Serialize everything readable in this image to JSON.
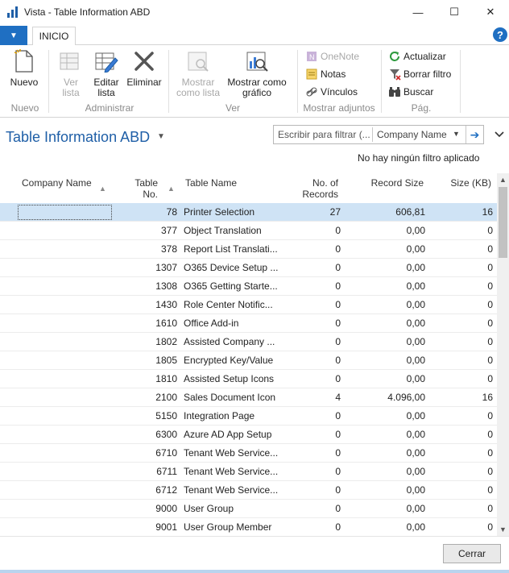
{
  "window": {
    "title": "Vista - Table Information ABD",
    "minimize_glyph": "—",
    "maximize_glyph": "☐",
    "close_glyph": "✕"
  },
  "ribbon_tabs": {
    "file_glyph": "▼",
    "active_tab": "INICIO",
    "help_glyph": "?"
  },
  "ribbon": {
    "groups": {
      "nuevo": "Nuevo",
      "administrar": "Administrar",
      "ver": "Ver",
      "mostrar_adjuntos": "Mostrar adjuntos",
      "pag": "Pág."
    },
    "buttons": {
      "nuevo": "Nuevo",
      "ver_lista": "Ver lista",
      "editar_lista": "Editar lista",
      "eliminar": "Eliminar",
      "mostrar_como_lista": "Mostrar como lista",
      "mostrar_como_grafico": "Mostrar como gráfico",
      "onenote": "OneNote",
      "notas": "Notas",
      "vinculos": "Vínculos",
      "actualizar": "Actualizar",
      "borrar_filtro": "Borrar filtro",
      "buscar": "Buscar"
    }
  },
  "page": {
    "title": "Table Information ABD",
    "filter_placeholder": "Escribir para filtrar (...",
    "filter_field": "Company Name",
    "no_filter_text": "No hay ningún filtro aplicado"
  },
  "table": {
    "columns": {
      "company_name": "Company Name",
      "table_no": "Table No.",
      "table_name": "Table Name",
      "no_of_records": "No. of Records",
      "record_size": "Record Size",
      "size_kb": "Size (KB)"
    },
    "rows": [
      {
        "company": "",
        "table_no": "78",
        "table_name": "Printer Selection",
        "records": "27",
        "record_size": "606,81",
        "size_kb": "16"
      },
      {
        "company": "",
        "table_no": "377",
        "table_name": "Object Translation",
        "records": "0",
        "record_size": "0,00",
        "size_kb": "0"
      },
      {
        "company": "",
        "table_no": "378",
        "table_name": "Report List Translati...",
        "records": "0",
        "record_size": "0,00",
        "size_kb": "0"
      },
      {
        "company": "",
        "table_no": "1307",
        "table_name": "O365 Device Setup ...",
        "records": "0",
        "record_size": "0,00",
        "size_kb": "0"
      },
      {
        "company": "",
        "table_no": "1308",
        "table_name": "O365 Getting Starte...",
        "records": "0",
        "record_size": "0,00",
        "size_kb": "0"
      },
      {
        "company": "",
        "table_no": "1430",
        "table_name": "Role Center Notific...",
        "records": "0",
        "record_size": "0,00",
        "size_kb": "0"
      },
      {
        "company": "",
        "table_no": "1610",
        "table_name": "Office Add-in",
        "records": "0",
        "record_size": "0,00",
        "size_kb": "0"
      },
      {
        "company": "",
        "table_no": "1802",
        "table_name": "Assisted Company ...",
        "records": "0",
        "record_size": "0,00",
        "size_kb": "0"
      },
      {
        "company": "",
        "table_no": "1805",
        "table_name": "Encrypted Key/Value",
        "records": "0",
        "record_size": "0,00",
        "size_kb": "0"
      },
      {
        "company": "",
        "table_no": "1810",
        "table_name": "Assisted Setup Icons",
        "records": "0",
        "record_size": "0,00",
        "size_kb": "0"
      },
      {
        "company": "",
        "table_no": "2100",
        "table_name": "Sales Document Icon",
        "records": "4",
        "record_size": "4.096,00",
        "size_kb": "16"
      },
      {
        "company": "",
        "table_no": "5150",
        "table_name": "Integration Page",
        "records": "0",
        "record_size": "0,00",
        "size_kb": "0"
      },
      {
        "company": "",
        "table_no": "6300",
        "table_name": "Azure AD App Setup",
        "records": "0",
        "record_size": "0,00",
        "size_kb": "0"
      },
      {
        "company": "",
        "table_no": "6710",
        "table_name": "Tenant Web Service...",
        "records": "0",
        "record_size": "0,00",
        "size_kb": "0"
      },
      {
        "company": "",
        "table_no": "6711",
        "table_name": "Tenant Web Service...",
        "records": "0",
        "record_size": "0,00",
        "size_kb": "0"
      },
      {
        "company": "",
        "table_no": "6712",
        "table_name": "Tenant Web Service...",
        "records": "0",
        "record_size": "0,00",
        "size_kb": "0"
      },
      {
        "company": "",
        "table_no": "9000",
        "table_name": "User Group",
        "records": "0",
        "record_size": "0,00",
        "size_kb": "0"
      },
      {
        "company": "",
        "table_no": "9001",
        "table_name": "User Group Member",
        "records": "0",
        "record_size": "0,00",
        "size_kb": "0"
      }
    ]
  },
  "footer": {
    "close_label": "Cerrar"
  }
}
